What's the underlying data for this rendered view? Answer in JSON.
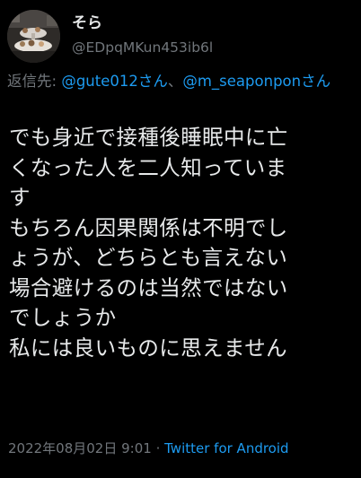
{
  "user": {
    "display_name": "そら",
    "handle": "@EDpqMKun453ib6l"
  },
  "reply": {
    "label": "返信先: ",
    "mention_1": "@gute012さん",
    "separator": "、",
    "mention_2": "@m_seaponponさん"
  },
  "tweet": {
    "text": "でも身近で接種後睡眠中に亡\nくなった人を二人知っていま\nす\nもちろん因果関係は不明でし\nょうが、どちらとも言えない\n場合避けるのは当然ではない\nでしょうか\n私には良いものに思えません"
  },
  "meta": {
    "timestamp": "2022年08月02日 9:01",
    "dot": " · ",
    "source": "Twitter for Android"
  },
  "colors": {
    "background": "#000000",
    "text": "#e7e9ea",
    "secondary": "#71767b",
    "accent": "#1d9bf0"
  }
}
